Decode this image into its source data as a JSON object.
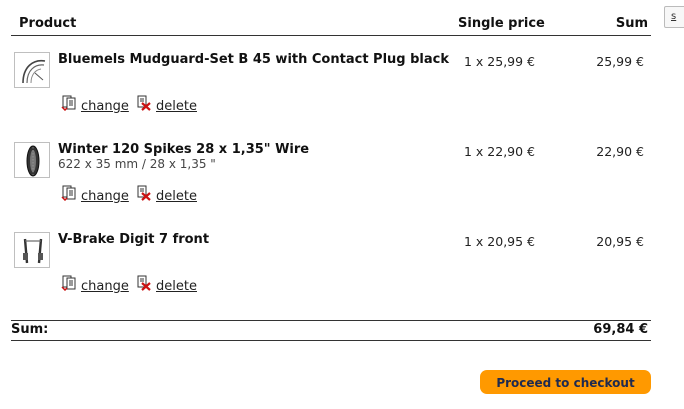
{
  "header": {
    "product": "Product",
    "single_price": "Single price",
    "sum": "Sum"
  },
  "side_button": {
    "label": "s"
  },
  "items": [
    {
      "name": "Bluemels Mudguard-Set B 45 with Contact Plug black",
      "subtitle": "",
      "quantity_price": "1 x 25,99 €",
      "sum": "25,99 €",
      "thumb_icon": "mudguard-icon"
    },
    {
      "name": "Winter 120 Spikes 28 x 1,35\" Wire",
      "subtitle": "622 x 35 mm / 28 x 1,35 \"",
      "quantity_price": "1 x 22,90 €",
      "sum": "22,90 €",
      "thumb_icon": "tire-icon"
    },
    {
      "name": "V-Brake Digit 7 front",
      "subtitle": "",
      "quantity_price": "1 x 20,95 €",
      "sum": "20,95 €",
      "thumb_icon": "v-brake-icon"
    }
  ],
  "actions": {
    "change": "change",
    "delete": "delete",
    "change_icon": "edit-document-icon",
    "delete_icon": "delete-document-icon"
  },
  "total": {
    "label": "Sum:",
    "value": "69,84 €"
  },
  "checkout": {
    "label": "Proceed to checkout"
  },
  "colors": {
    "accent": "#ff9900",
    "button_text": "#1e2a50",
    "delete_red": "#cc1111"
  }
}
